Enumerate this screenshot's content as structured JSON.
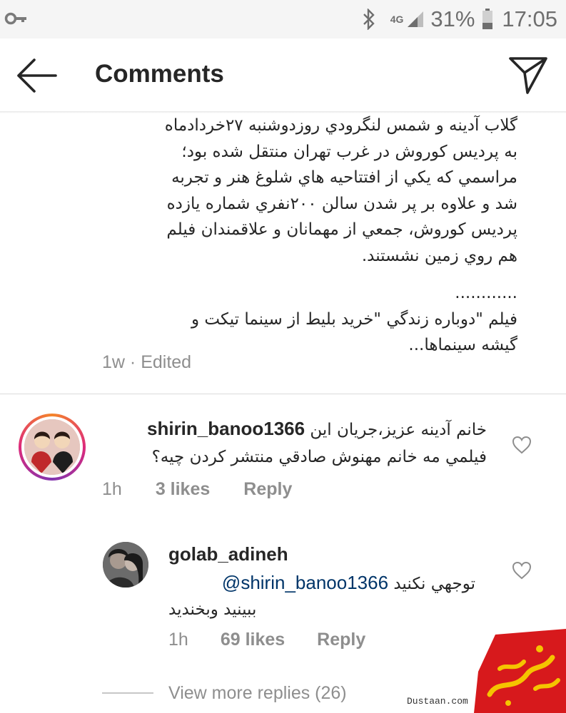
{
  "status_bar": {
    "network": "4G",
    "battery_percent": "31%",
    "time": "17:05",
    "icons": [
      "key-icon",
      "bluetooth-icon",
      "signal-icon",
      "battery-icon"
    ]
  },
  "header": {
    "title": "Comments",
    "back_icon": "arrow-left-icon",
    "send_icon": "paper-plane-icon"
  },
  "caption": {
    "lines_p1": [
      "گلاب آدينه و شمس لنگرودي روزدوشنبه ۲۷خردادماه",
      "به پرديس كوروش در غرب تهران منتقل شده بود؛",
      "مراسمي كه يكي از افتتاحيه هاي شلوغ هنر و تجربه",
      "شد و علاوه بر پر شدن سالن ۲۰۰نفري شماره يازده",
      "پرديس كوروش، جمعي از مهمانان و علاقمندان فيلم",
      "هم روي زمين نشستند."
    ],
    "dots": "............",
    "lines_p2": [
      "فيلم \"دوباره زندگي \"خريد بليط از سينما تيكت و",
      "گيشه سينماها..."
    ],
    "time": "1w",
    "separator": "·",
    "edited": "Edited"
  },
  "comments": [
    {
      "username": "shirin_banoo1366",
      "text_line1": "خانم آدينه عزيز،جريان اين",
      "text_line2": "فيلمي مه خانم مهنوش صادقي منتشر كردن چيه؟",
      "time": "1h",
      "likes": "3 likes",
      "reply": "Reply"
    }
  ],
  "replies": [
    {
      "username": "golab_adineh",
      "mention": "@shirin_banoo1366",
      "text_line1": "توجهي نكنيد",
      "text_line2": "ببينيد وبخنديد",
      "time": "1h",
      "likes": "69 likes",
      "reply": "Reply"
    }
  ],
  "view_more": "View more replies (26)",
  "watermark": {
    "site": "Dustaan.com"
  },
  "colors": {
    "text": "#262626",
    "secondary": "#8e8e8e",
    "mention": "#003569",
    "watermark_red": "#d7191c",
    "watermark_yellow": "#f5c400"
  }
}
